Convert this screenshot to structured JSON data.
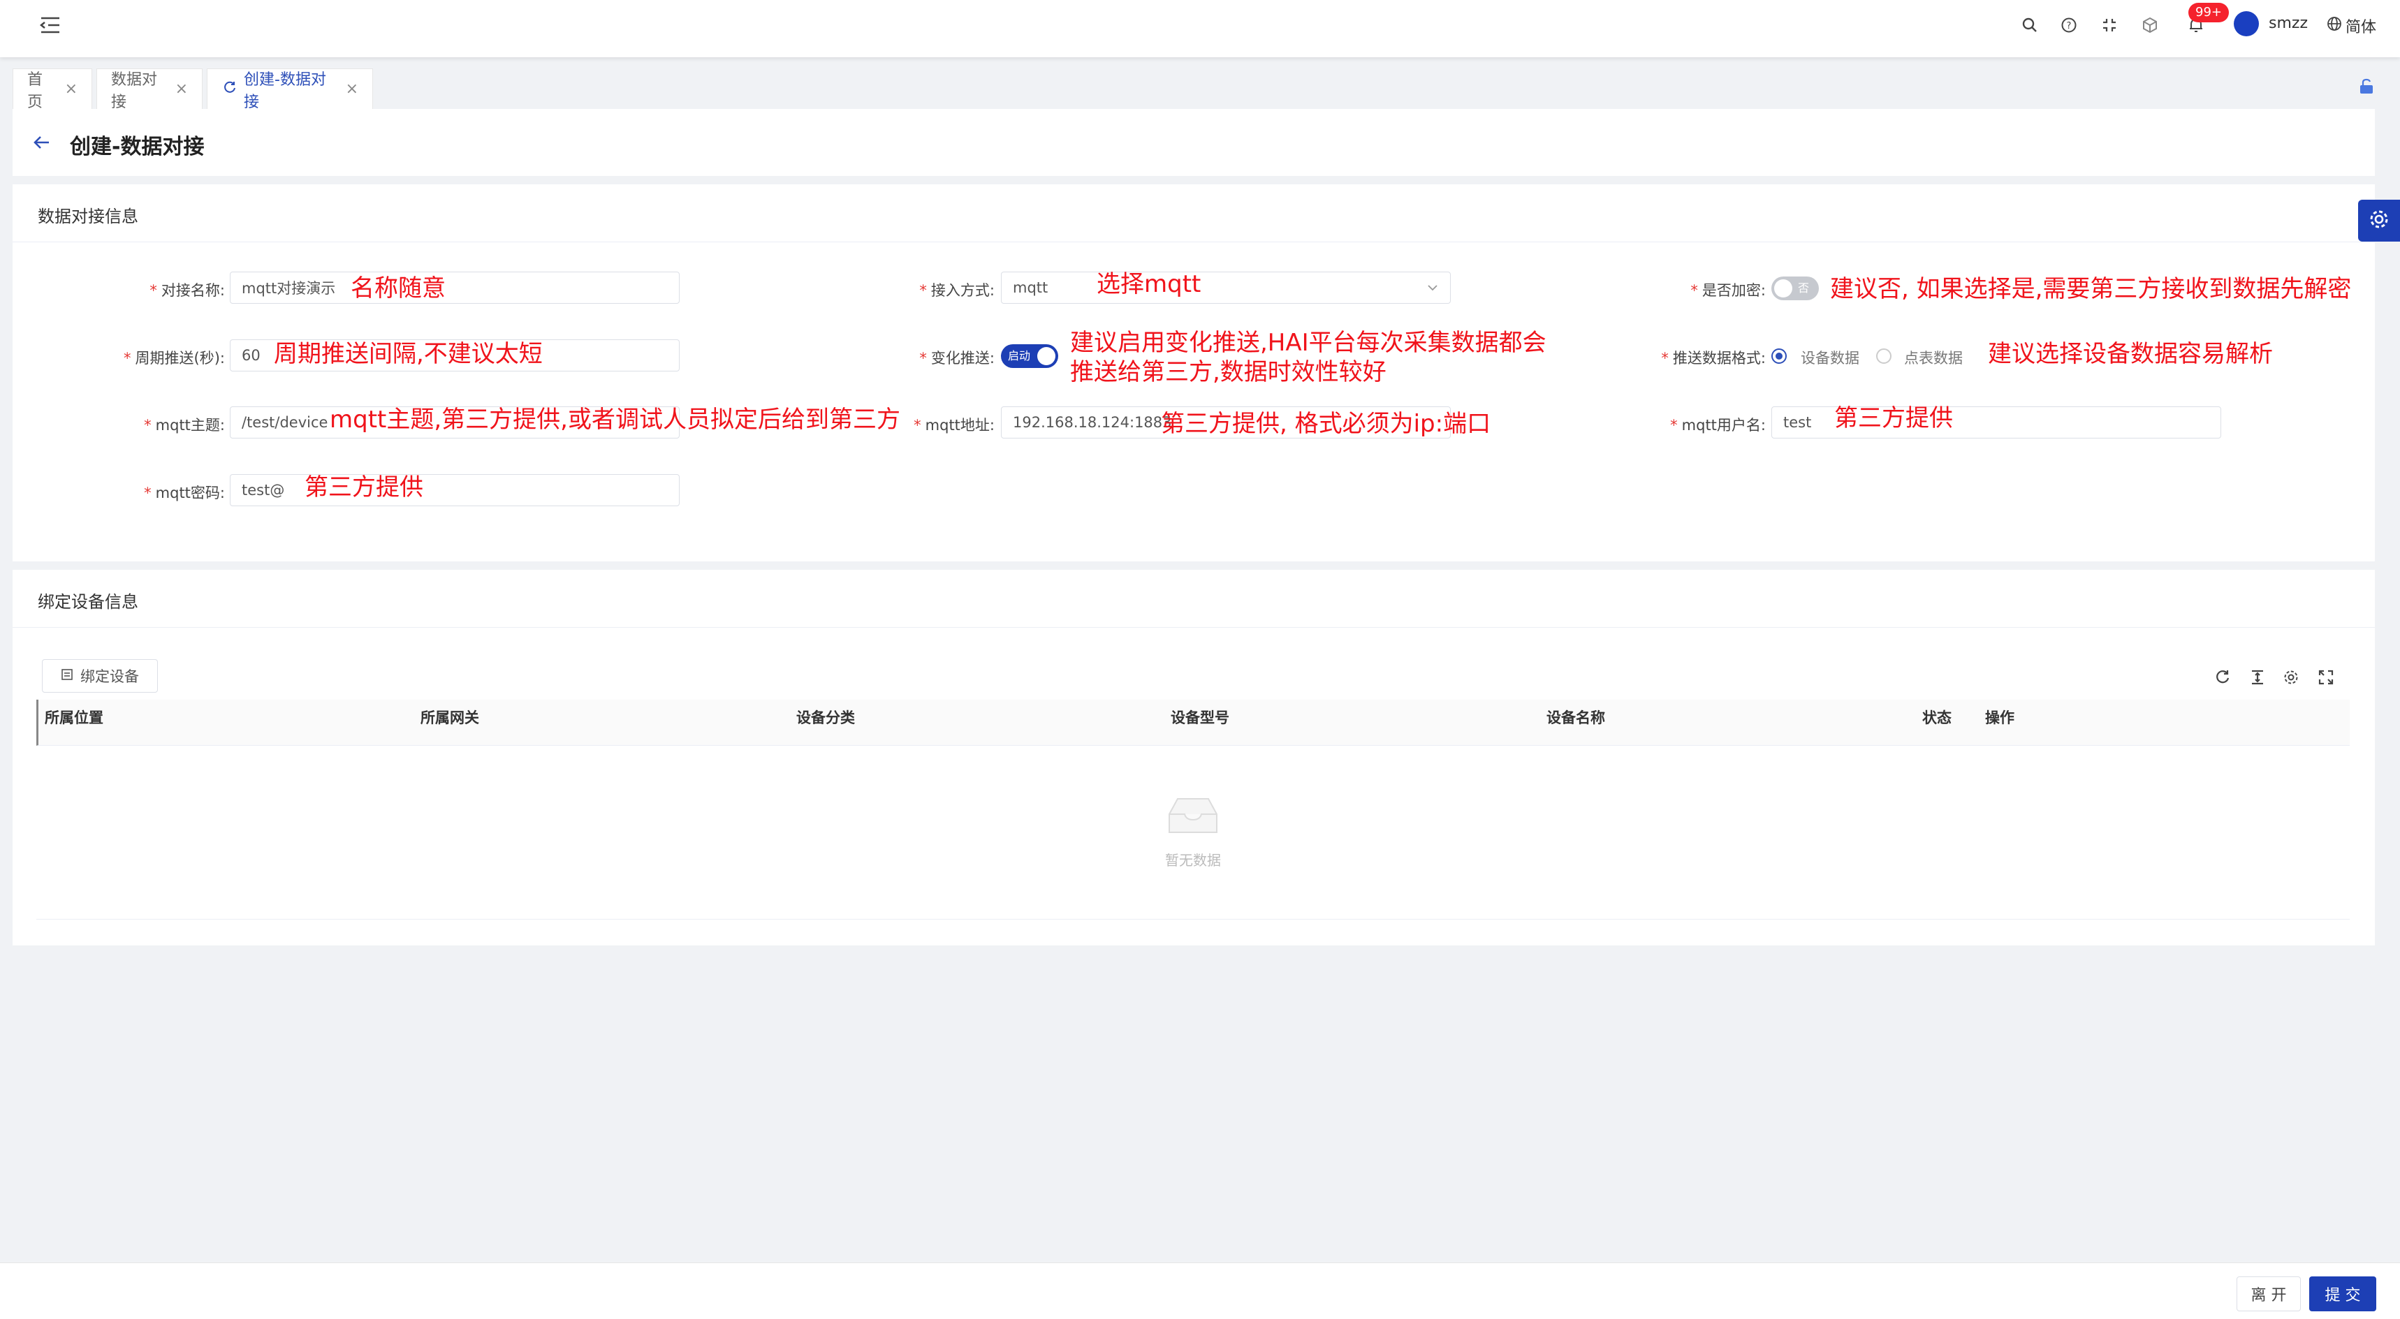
{
  "header": {
    "menu_icon": "menu-fold-icon",
    "notification_badge": "99+",
    "username": "smzz",
    "language": "简体",
    "icons": [
      "search-icon",
      "help-icon",
      "fullscreen-icon",
      "cube-icon",
      "bell-icon"
    ]
  },
  "tabs": [
    {
      "label": "首页",
      "active": false
    },
    {
      "label": "数据对接",
      "active": false
    },
    {
      "label": "创建-数据对接",
      "active": true
    }
  ],
  "page": {
    "title": "创建-数据对接"
  },
  "form_section": {
    "title": "数据对接信息",
    "name_label": "对接名称:",
    "name_value": "mqtt对接演示",
    "name_note": "名称随意",
    "access_label": "接入方式:",
    "access_value": "mqtt",
    "access_note": "选择mqtt",
    "encrypt_label": "是否加密:",
    "encrypt_switch_text": "否",
    "encrypt_note": "建议否, 如果选择是,需要第三方接收到数据先解密",
    "period_label": "周期推送(秒):",
    "period_value": "60",
    "period_note": "周期推送间隔,不建议太短",
    "change_label": "变化推送:",
    "change_switch_text": "启动",
    "change_note_line1": "建议启用变化推送,HAI平台每次采集数据都会",
    "change_note_line2": "推送给第三方,数据时效性较好",
    "format_label": "推送数据格式:",
    "format_option1": "设备数据",
    "format_option2": "点表数据",
    "format_note": "建议选择设备数据容易解析",
    "topic_label": "mqtt主题:",
    "topic_value": "/test/device",
    "topic_note": "mqtt主题,第三方提供,或者调试人员拟定后给到第三方",
    "address_label": "mqtt地址:",
    "address_value": "192.168.18.124:1883",
    "address_note": "第三方提供, 格式必须为ip:端口",
    "username_label": "mqtt用户名:",
    "username_value": "test",
    "username_note": "第三方提供",
    "password_label": "mqtt密码:",
    "password_value": "test@",
    "password_note": "第三方提供"
  },
  "device_section": {
    "title": "绑定设备信息",
    "bind_button": "绑定设备",
    "columns": [
      "所属位置",
      "所属网关",
      "设备分类",
      "设备型号",
      "设备名称",
      "状态",
      "操作"
    ],
    "empty_text": "暂无数据"
  },
  "footer": {
    "leave_button": "离 开",
    "submit_button": "提 交"
  },
  "colors": {
    "primary": "#2d4fb8",
    "annotation": "#f0131b",
    "badge": "#f5222d"
  }
}
